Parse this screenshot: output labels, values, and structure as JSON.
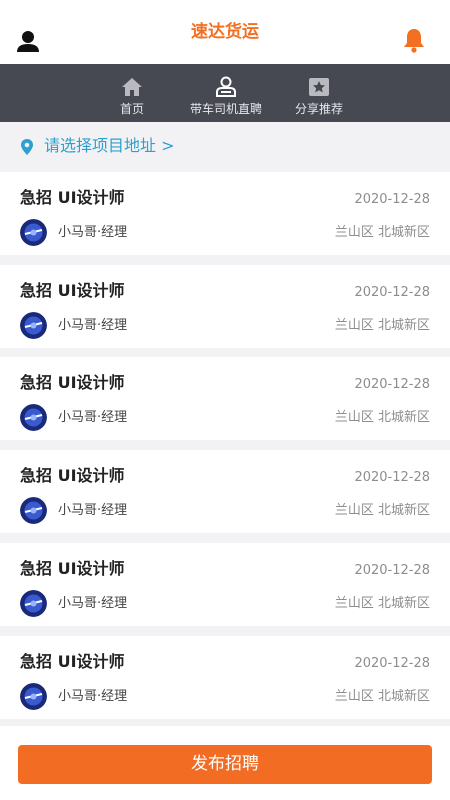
{
  "header": {
    "title": "速达货运",
    "user_icon": "user-icon",
    "bell_icon": "bell-icon",
    "accent_color": "#f36f21"
  },
  "nav": {
    "items": [
      {
        "label": "首页",
        "icon": "home-icon"
      },
      {
        "label": "带车司机直聘",
        "icon": "driver-icon"
      },
      {
        "label": "分享推荐",
        "icon": "star-icon"
      }
    ]
  },
  "address": {
    "label": "请选择项目地址 >",
    "icon": "location-pin-icon"
  },
  "jobs": [
    {
      "title": "急招 UI设计师",
      "date": "2020-12-28",
      "poster": "小马哥·经理",
      "location": "兰山区 北城新区"
    },
    {
      "title": "急招 UI设计师",
      "date": "2020-12-28",
      "poster": "小马哥·经理",
      "location": "兰山区 北城新区"
    },
    {
      "title": "急招 UI设计师",
      "date": "2020-12-28",
      "poster": "小马哥·经理",
      "location": "兰山区 北城新区"
    },
    {
      "title": "急招 UI设计师",
      "date": "2020-12-28",
      "poster": "小马哥·经理",
      "location": "兰山区 北城新区"
    },
    {
      "title": "急招 UI设计师",
      "date": "2020-12-28",
      "poster": "小马哥·经理",
      "location": "兰山区 北城新区"
    },
    {
      "title": "急招 UI设计师",
      "date": "2020-12-28",
      "poster": "小马哥·经理",
      "location": "兰山区 北城新区"
    }
  ],
  "footer": {
    "publish_label": "发布招聘"
  }
}
